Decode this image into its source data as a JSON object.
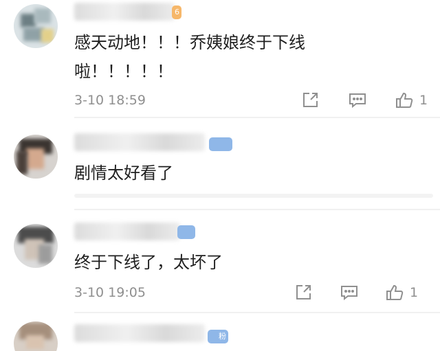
{
  "comments": [
    {
      "text_lines": [
        "感天动地！！！乔姨娘终于下线",
        "啦！！！！！"
      ],
      "time": "3-10 18:59",
      "likes": "1",
      "has_actions": true,
      "badge_text": "6",
      "badge_color": "#f6b76a"
    },
    {
      "text_lines": [
        "剧情太好看了"
      ],
      "time": "",
      "likes": "",
      "has_actions": false,
      "badge_text": "",
      "badge_color": "#8fb7e8"
    },
    {
      "text_lines": [
        "终于下线了，太坏了"
      ],
      "time": "3-10 19:05",
      "likes": "1",
      "has_actions": true,
      "badge_text": "",
      "badge_color": "#8fb7e8"
    },
    {
      "text_lines": [],
      "time": "",
      "likes": "",
      "has_actions": false,
      "badge_text": "粉",
      "badge_color": "#8fb7e8"
    }
  ],
  "icons": {
    "share": "share-icon",
    "comment": "comment-icon",
    "like": "thumbs-up-icon"
  },
  "colors": {
    "text": "#1f1f1f",
    "meta": "#8f8f8f",
    "divider": "#f0f0f0"
  }
}
